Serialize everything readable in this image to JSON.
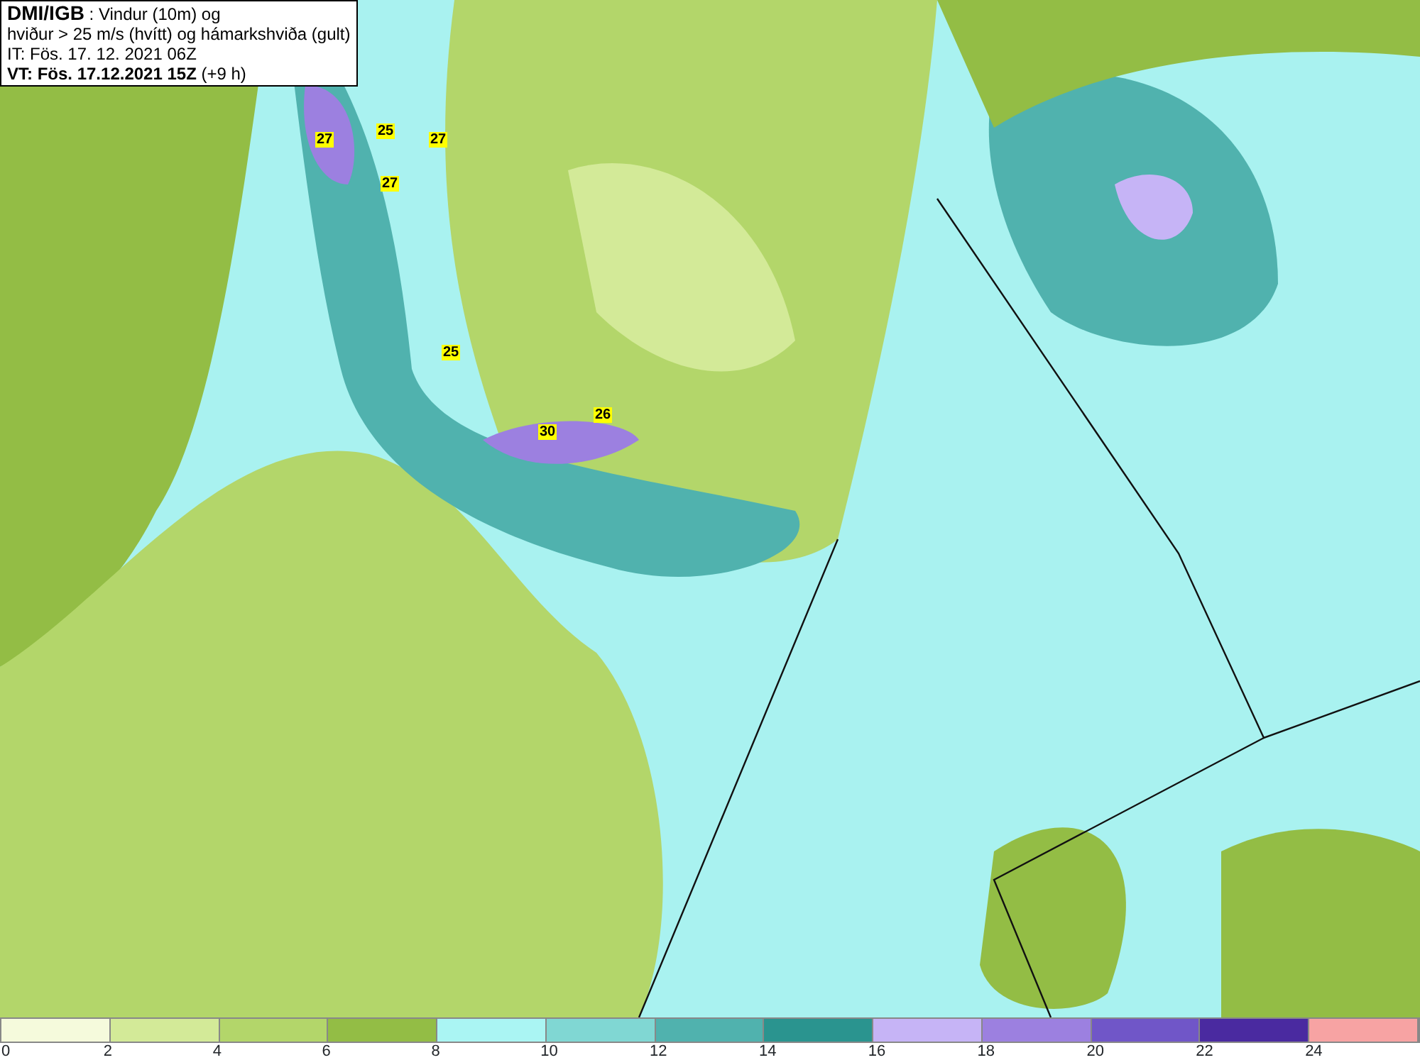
{
  "header": {
    "lines": [
      "**DMI/IGB** : Vindur (10m) og",
      "hviður > 25 m/s (hvítt) og hámarkshviða (gult)",
      "IT: Fös. 17. 12. 2021 06Z",
      "**VT: Fös. 17.12.2021 15Z** (+9 h)"
    ]
  },
  "map": {
    "gust_labels": [
      "27",
      "25",
      "27",
      "27",
      "25",
      "30",
      "26"
    ]
  },
  "legend": {
    "bins": [
      {
        "color": "#f5fadc"
      },
      {
        "color": "#d3ea98"
      },
      {
        "color": "#b3d66a"
      },
      {
        "color": "#93bd45"
      },
      {
        "color": "#aaf5f3"
      },
      {
        "color": "#80d7d3"
      },
      {
        "color": "#50b2ae"
      },
      {
        "color": "#2a948f"
      },
      {
        "color": "#c6b4f6"
      },
      {
        "color": "#9c80e0"
      },
      {
        "color": "#7056c8"
      },
      {
        "color": "#4a2aa0"
      },
      {
        "color": "#f7a3a3"
      }
    ],
    "ticks": [
      "0",
      "2",
      "4",
      "6",
      "8",
      "10",
      "12",
      "14",
      "16",
      "18",
      "20",
      "22",
      "24"
    ]
  }
}
